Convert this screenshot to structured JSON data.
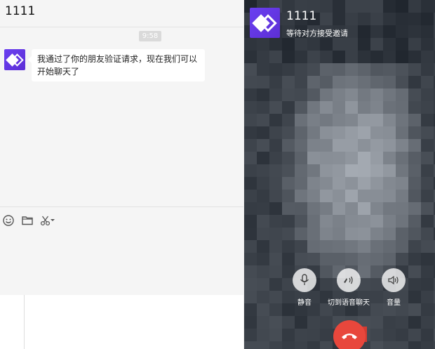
{
  "chat": {
    "title": "1111",
    "timestamp": "9:58",
    "messages": [
      {
        "text_line1": "我通过了你的朋友验证请求，现在我们可以",
        "text_line2": "开始聊天了"
      }
    ],
    "toolbar": {
      "icons": [
        "emoji-icon",
        "folder-icon",
        "scissors-icon",
        "caret-down-icon"
      ]
    }
  },
  "call": {
    "caller_name": "1111",
    "status": "等待对方接受邀请",
    "controls": [
      {
        "label": "静音",
        "icon": "microphone-icon"
      },
      {
        "label": "切到语音聊天",
        "icon": "voice-switch-icon"
      },
      {
        "label": "音量",
        "icon": "speaker-icon"
      }
    ],
    "hangup_icon": "hangup-phone-icon"
  },
  "colors": {
    "avatar": "#6a3ff0",
    "hangup": "#e8473c",
    "chat_bg": "#f5f5f5",
    "bubble_bg": "#ffffff"
  }
}
